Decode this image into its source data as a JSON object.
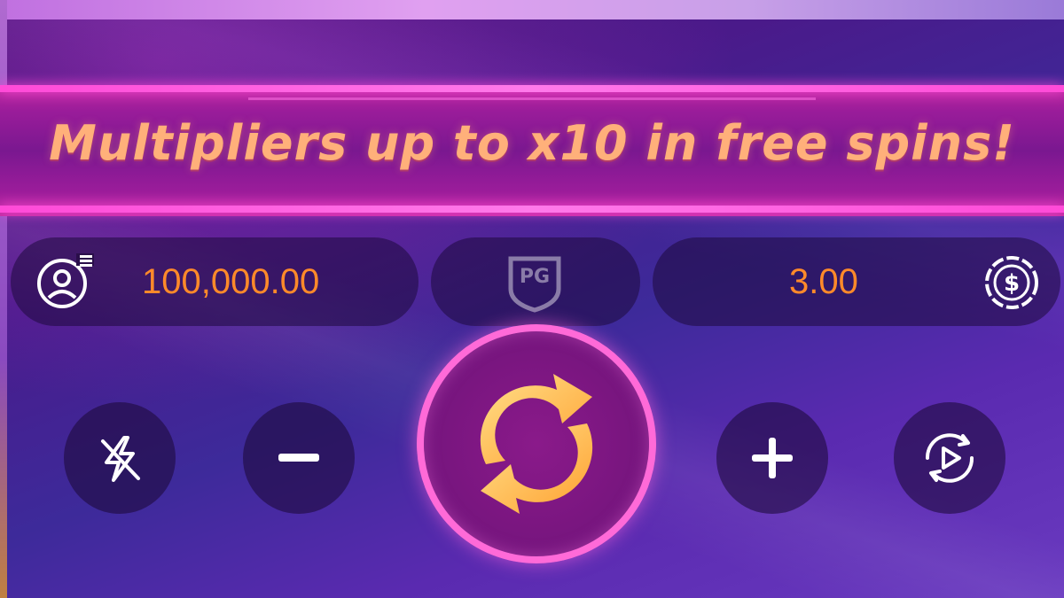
{
  "banner": {
    "text": "Multipliers up to x10 in free spins!"
  },
  "balance": {
    "value": "100,000.00",
    "icon": "account-menu-icon"
  },
  "brand": {
    "logo_text": "PG"
  },
  "bet": {
    "value": "3.00",
    "icon": "dollar-coin-icon"
  },
  "controls": {
    "turbo_icon": "turbo-off-icon",
    "decrease_icon": "minus-icon",
    "spin_icon": "spin-arrows-icon",
    "increase_icon": "plus-icon",
    "autoplay_icon": "autoplay-icon"
  },
  "colors": {
    "accent_orange": "#ff8a2a",
    "banner_text": "#ffb07a",
    "neon_pink": "#ff4ad8"
  }
}
